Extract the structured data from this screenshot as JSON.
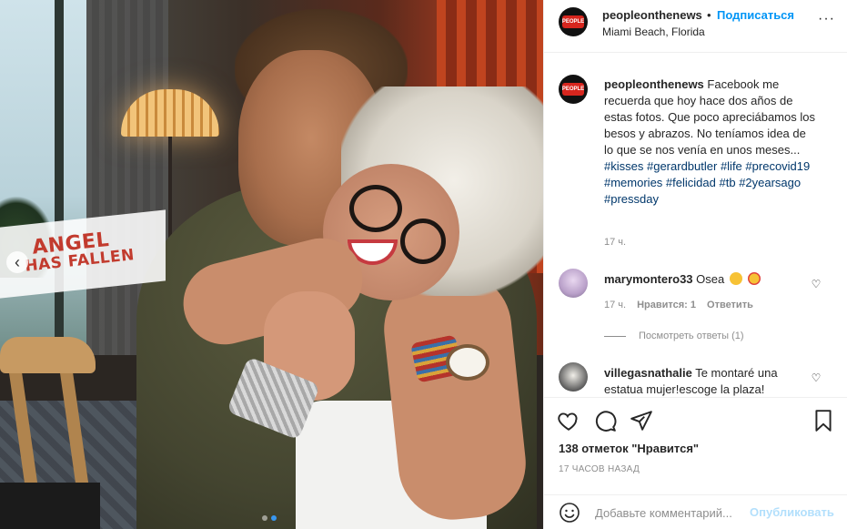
{
  "photo": {
    "banner_line1": "Angel",
    "banner_line2": "Has Fallen",
    "prev_glyph": "‹",
    "dots": [
      false,
      true
    ]
  },
  "header": {
    "username": "peopleonthenews",
    "separator": "•",
    "follow_label": "Подписаться",
    "location": "Miami Beach, Florida",
    "more_glyph": "···"
  },
  "caption": {
    "username": "peopleonthenews",
    "text": "Facebook me recuerda que hoy hace dos años de estas fotos. Que poco apreciábamos los besos y abrazos. No teníamos idea de lo que se nos venía en unos meses...",
    "hashtags": [
      "#kisses",
      "#gerardbutler",
      "#life",
      "#precovid19",
      "#memories",
      "#felicidad",
      "#tb",
      "#2yearsago",
      "#pressday"
    ],
    "time": "17 ч."
  },
  "comments": [
    {
      "username": "marymontero33",
      "text": "Osea",
      "time": "17 ч.",
      "likes_label": "Нравится: 1",
      "reply_label": "Ответить",
      "view_replies": "Посмотреть ответы (1)"
    },
    {
      "username": "villegasnathalie",
      "text": "Te montaré una estatua mujer!escoge la plaza!"
    }
  ],
  "actions": {
    "likes_text": "138 отметок \"Нравится\"",
    "post_time": "17 часов назад"
  },
  "add_comment": {
    "placeholder": "Добавьте комментарий...",
    "publish_label": "Опубликовать"
  },
  "colors": {
    "accent": "#0095f6",
    "publish_disabled": "#b2dffc",
    "meta": "#8e8e8e",
    "hashtag": "#00376b"
  }
}
